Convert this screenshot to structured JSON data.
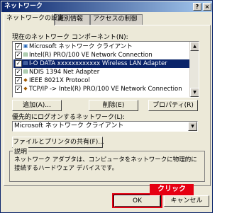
{
  "window": {
    "title": "ネットワーク",
    "help_glyph": "?",
    "close_glyph": "×"
  },
  "tabs": [
    {
      "label": "ネットワークの設定"
    },
    {
      "label": "識別情報"
    },
    {
      "label": "アクセスの制御"
    }
  ],
  "components": {
    "label": "現在のネットワーク コンポーネント(N):",
    "items": [
      {
        "label": "Microsoft ネットワーク クライアント",
        "icon": "client-icon"
      },
      {
        "label": "Intel(R) PRO/100 VE Network Connection",
        "icon": "adapter-icon"
      },
      {
        "label": "I-O DATA  xxxxxxxxxxxx  Wireless LAN Adapter",
        "icon": "adapter-icon",
        "selected": true
      },
      {
        "label": "NDIS 1394 Net Adapter",
        "icon": "adapter-icon"
      },
      {
        "label": "IEEE 8021X Protocol",
        "icon": "protocol-icon"
      },
      {
        "label": "TCP/IP -> Intel(R) PRO/100 VE Network Connection",
        "icon": "protocol-icon"
      }
    ],
    "check_glyph": "✓"
  },
  "buttons": {
    "add": "追加(A)...",
    "remove": "削除(E)",
    "properties": "プロパティ(R)"
  },
  "logon": {
    "label": "優先的にログオンするネットワーク(L):",
    "value": "Microsoft ネットワーク クライアント"
  },
  "file_sharing_button": "ファイルとプリンタの共有(F)...",
  "description": {
    "title": "説明",
    "text": "ネットワーク アダプタは、コンピュータをネットワークに物理的に接続するハードウェア デバイスです。"
  },
  "footer": {
    "ok": "OK",
    "cancel": "キャンセル"
  },
  "annotation": {
    "callout_text": "クリック",
    "color": "#e60012"
  }
}
